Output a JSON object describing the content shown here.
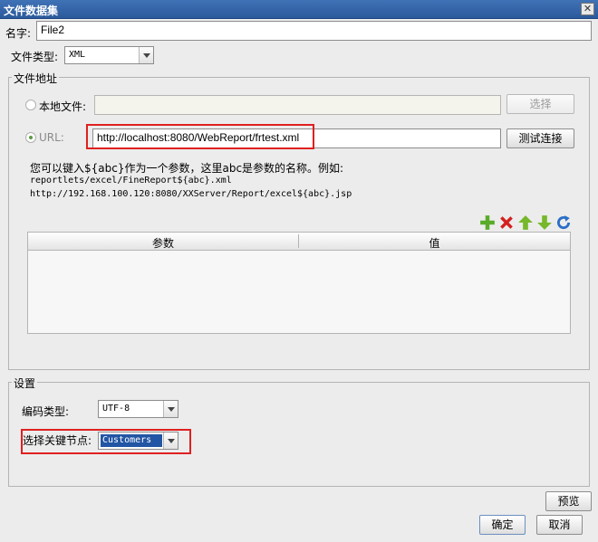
{
  "window": {
    "title": "文件数据集",
    "close_glyph": "✕"
  },
  "name": {
    "label": "名字:",
    "value": "File2"
  },
  "file_type": {
    "label": "文件类型:",
    "value": "XML"
  },
  "address": {
    "legend": "文件地址",
    "local_label": "本地文件:",
    "local_value": "",
    "choose_button": "选择",
    "url_label": "URL:",
    "url_value": "http://localhost:8080/WebReport/frtest.xml",
    "test_button": "测试连接",
    "hint_line1": "您可以键入${abc}作为一个参数，这里abc是参数的名称。例如:",
    "hint_line2": "reportlets/excel/FineReport${abc}.xml",
    "hint_line3": "http://192.168.100.120:8080/XXServer/Report/excel${abc}.jsp"
  },
  "toolbar": {
    "icons": [
      "add-icon",
      "delete-icon",
      "move-up-icon",
      "move-down-icon",
      "refresh-icon"
    ]
  },
  "param_table": {
    "columns": [
      "参数",
      "值"
    ],
    "rows": []
  },
  "settings": {
    "legend": "设置",
    "encoding_label": "编码类型:",
    "encoding_value": "UTF-8",
    "node_label": "选择关键节点:",
    "node_value": "Customers"
  },
  "buttons": {
    "preview": "预览",
    "ok": "确定",
    "cancel": "取消"
  },
  "colors": {
    "title_bar": "#2c5a9c",
    "highlight_box": "#e02020",
    "selected_combo": "#2255a4"
  }
}
